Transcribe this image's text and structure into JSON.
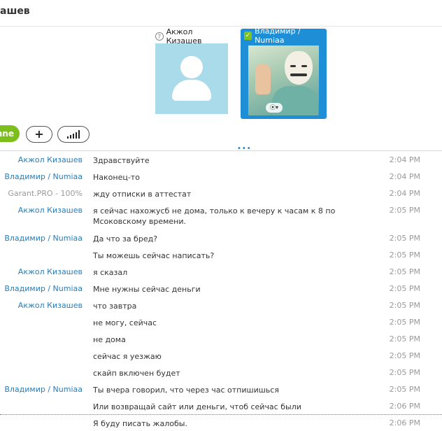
{
  "header": {
    "title": "ашев"
  },
  "participants": [
    {
      "name": "Акжол Кизашев"
    },
    {
      "name": "Владимир / Numiaa"
    }
  ],
  "toolbar": {
    "online_label": "nne"
  },
  "messages": [
    {
      "sender": "Акжол Кизашев",
      "text": "Здравствуйте",
      "time": "2:04 PM"
    },
    {
      "sender": "Владимир / Numiaa",
      "text": "Наконец-то",
      "time": "2:04 PM"
    },
    {
      "sender": "Garant.PRO - 100%",
      "text": "жду отписки в аттестат",
      "time": "2:04 PM"
    },
    {
      "sender": "Акжол Кизашев",
      "text": "я сейчас нахожусб не дома, только к вечеру к часам к 8 по Мсоковскому времени.",
      "time": "2:05 PM"
    },
    {
      "sender": "Владимир / Numiaa",
      "text": "Да что за бред?",
      "time": "2:05 PM"
    },
    {
      "sender": "",
      "text": "Ты можешь сейчас написать?",
      "time": "2:05 PM"
    },
    {
      "sender": "Акжол Кизашев",
      "text": "я сказал",
      "time": "2:05 PM"
    },
    {
      "sender": "Владимир / Numiaa",
      "text": "Мне нужны сейчас деньги",
      "time": "2:05 PM"
    },
    {
      "sender": "Акжол Кизашев",
      "text": "что завтра",
      "time": "2:05 PM"
    },
    {
      "sender": "",
      "text": "не могу, сейчас",
      "time": "2:05 PM"
    },
    {
      "sender": "",
      "text": "не дома",
      "time": "2:05 PM"
    },
    {
      "sender": "",
      "text": "сейчас я уезжаю",
      "time": "2:05 PM"
    },
    {
      "sender": "",
      "text": "скайп включен будет",
      "time": "2:05 PM"
    },
    {
      "sender": "Владимир / Numiaa",
      "text": "Ты вчера говорил, что через час отпишишься",
      "time": "2:05 PM"
    },
    {
      "sender": "",
      "text": "Или возвращай сайт или деньги, чтоб сейчас были",
      "time": "2:06 PM"
    },
    {
      "sender": "",
      "text": "Я буду писать жалобы.",
      "time": "2:06 PM"
    }
  ]
}
